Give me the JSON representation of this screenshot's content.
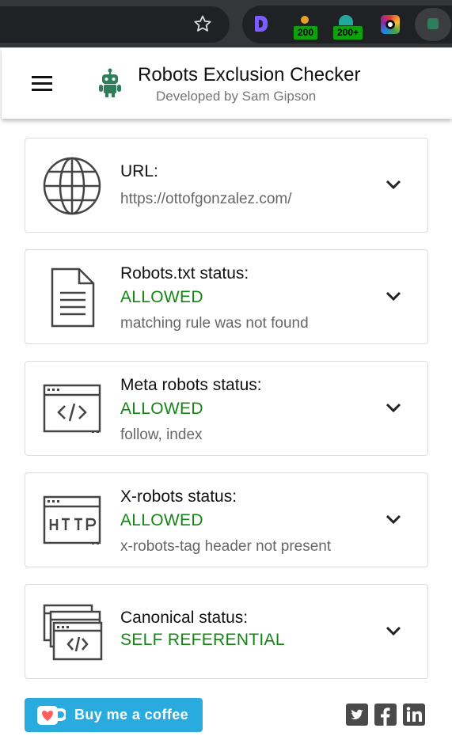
{
  "browser": {
    "badges": [
      "200",
      "200+"
    ],
    "icons": [
      "star-icon",
      "extension-d-icon",
      "extension-status-icon",
      "extension-status-plus-icon",
      "extension-color-icon",
      "robots-extension-icon"
    ]
  },
  "header": {
    "title": "Robots Exclusion Checker",
    "subtitle": "Developed by Sam Gipson"
  },
  "cards": [
    {
      "label": "URL:",
      "status": "",
      "detail": "https://ottofgonzalez.com/",
      "icon": "globe-icon"
    },
    {
      "label": "Robots.txt status:",
      "status": "ALLOWED",
      "detail": "matching rule was not found",
      "icon": "document-icon"
    },
    {
      "label": "Meta robots status:",
      "status": "ALLOWED",
      "detail": "follow, index",
      "icon": "code-window-icon"
    },
    {
      "label": "X-robots status:",
      "status": "ALLOWED",
      "detail": "x-robots-tag header not present",
      "icon": "http-window-icon"
    },
    {
      "label": "Canonical status:",
      "status": "SELF REFERENTIAL",
      "detail": "",
      "icon": "stacked-windows-icon"
    }
  ],
  "footer": {
    "coffee_label": "Buy me a coffee",
    "social": [
      "twitter-icon",
      "facebook-icon",
      "linkedin-icon"
    ]
  },
  "colors": {
    "status_green": "#148514",
    "coffee_blue": "#29abe0",
    "brand_green": "#2e7d5b"
  }
}
